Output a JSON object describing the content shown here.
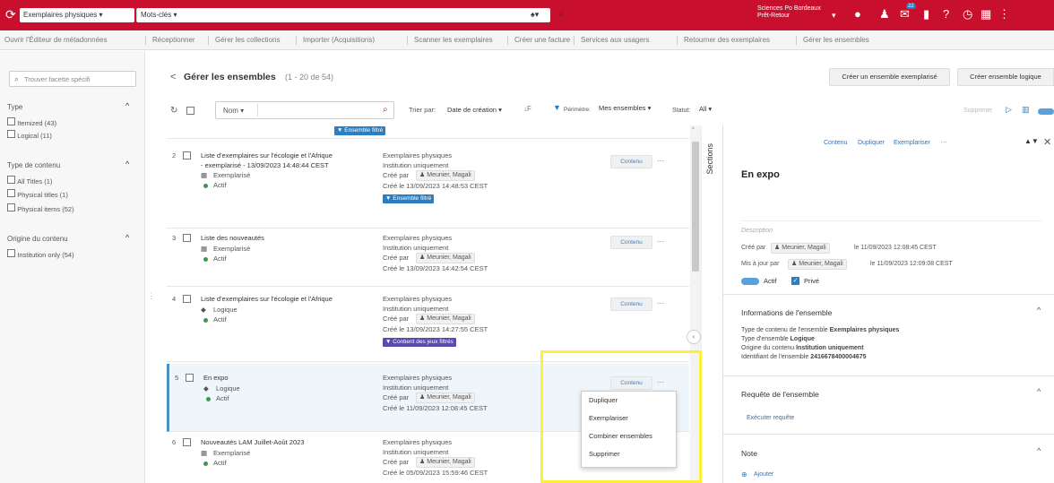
{
  "topbar": {
    "search_scope": "Exemplaires physiques",
    "search_type": "Mots-clés",
    "institution_line1": "Sciences Po Bordeaux",
    "institution_line2": "Prêt-Retour",
    "notification_count": "22"
  },
  "menu": [
    "Ouvrir l'Éditeur de métadonnées",
    "Réceptionner",
    "Gérer les collections",
    "Importer (Acquisitions)",
    "Scanner les exemplaires",
    "Créer une facture",
    "Services aux usagers",
    "Retourner des exemplaires",
    "Gérer les ensembles"
  ],
  "sidebar": {
    "search_placeholder": "Trouver facette spécifi",
    "groups": [
      {
        "title": "Type",
        "items": [
          "Itemized (43)",
          "Logical (11)"
        ]
      },
      {
        "title": "Type de contenu",
        "items": [
          "All Titles (1)",
          "Physical titles (1)",
          "Physical items (52)"
        ]
      },
      {
        "title": "Origine du contenu",
        "items": [
          "Institution only (54)"
        ]
      }
    ]
  },
  "header": {
    "back": "<",
    "title": "Gérer les ensembles",
    "count": "(1 - 20 de 54)",
    "btn_create_itemized": "Créer un ensemble exemplarisé",
    "btn_create_logical": "Créer ensemble logique"
  },
  "toolbar": {
    "name_select": "Nom",
    "sort_label": "Trier par:",
    "sort_value": "Date de création",
    "perimeter_label": "Périmètre:",
    "perimeter_value": "Mes ensembles",
    "status_label": "Statut:",
    "status_value": "All",
    "delete_label": "Supprimer"
  },
  "rows": [
    {
      "num": "2",
      "title1": "Liste d'exemplaires sur l'écologie et l'Afrique",
      "title2": "- exemplarisé - 13/09/2023 14:48:44 CEST",
      "type": "Exemplarisé",
      "status": "Actif",
      "content": "Exemplaires physiques",
      "origin": "Institution uniquement",
      "created_by_label": "Créé par",
      "creator": "Meunier, Magali",
      "created_on": "Créé le 13/09/2023 14:48:53 CEST",
      "badge": "Ensemble filtré",
      "btn": "Contenu"
    },
    {
      "num": "3",
      "title1": "Liste des nouveautés",
      "title2": "",
      "type": "Exemplarisé",
      "status": "Actif",
      "content": "Exemplaires physiques",
      "origin": "Institution uniquement",
      "created_by_label": "Créé par",
      "creator": "Meunier, Magali",
      "created_on": "Créé le 13/09/2023 14:42:54 CEST",
      "badge": "",
      "btn": "Contenu"
    },
    {
      "num": "4",
      "title1": "Liste d'exemplaires sur l'écologie et l'Afrique",
      "title2": "",
      "type": "Logique",
      "status": "Actif",
      "content": "Exemplaires physiques",
      "origin": "Institution uniquement",
      "created_by_label": "Créé par",
      "creator": "Meunier, Magali",
      "created_on": "Créé le 13/09/2023 14:27:55 CEST",
      "badge": "Contient des jeux filtrés",
      "btn": "Contenu"
    },
    {
      "num": "5",
      "title1": "En expo",
      "title2": "",
      "type": "Logique",
      "status": "Actif",
      "content": "Exemplaires physiques",
      "origin": "Institution uniquement",
      "created_by_label": "Créé par",
      "creator": "Meunier, Magali",
      "created_on": "Créé le 11/09/2023 12:08:45 CEST",
      "badge": "",
      "btn": "Contenu"
    },
    {
      "num": "6",
      "title1": "Nouveautés LAM Juillet-Août 2023",
      "title2": "",
      "type": "Exemplarisé",
      "status": "Actif",
      "content": "Exemplaires physiques",
      "origin": "Institution uniquement",
      "created_by_label": "Créé par",
      "creator": "Meunier, Magali",
      "created_on": "Créé le 05/09/2023 15:59:46 CEST",
      "badge": "",
      "btn": "Contenu"
    }
  ],
  "top_badge": "Ensemble filtré",
  "dropdown": [
    "Dupliquer",
    "Exemplariser",
    "Combiner ensembles",
    "Supprimer"
  ],
  "sections_label": "Sections",
  "panel": {
    "actions": [
      "Contenu",
      "Dupliquer",
      "Exemplariser"
    ],
    "title": "En expo",
    "description_placeholder": "Description",
    "created_by_label": "Créé par",
    "creator": "Meunier, Magali",
    "created_on": "le 11/09/2023 12:08:45 CEST",
    "updated_by_label": "Mis à jour par",
    "updater": "Meunier, Magali",
    "updated_on": "le 11/09/2023 12:09:08 CEST",
    "active_label": "Actif",
    "private_label": "Privé",
    "info_title": "Informations de l'ensemble",
    "info_lines": [
      {
        "label": "Type de contenu de l'ensemble",
        "value": "Exemplaires physiques"
      },
      {
        "label": "Type d'ensemble",
        "value": "Logique"
      },
      {
        "label": "Origine du contenu",
        "value": "Institution uniquement"
      },
      {
        "label": "Identifiant de l'ensemble",
        "value": "2416678400004675"
      }
    ],
    "query_title": "Requête de l'ensemble",
    "query_link": "Exécuter requête",
    "note_title": "Note",
    "add_label": "Ajouter"
  },
  "colors": {
    "brand": "#c8102e",
    "highlight": "#ffef3a",
    "link": "#3a72b0",
    "badge_blue": "#2a7fc4",
    "badge_purple": "#5a4ab0"
  }
}
